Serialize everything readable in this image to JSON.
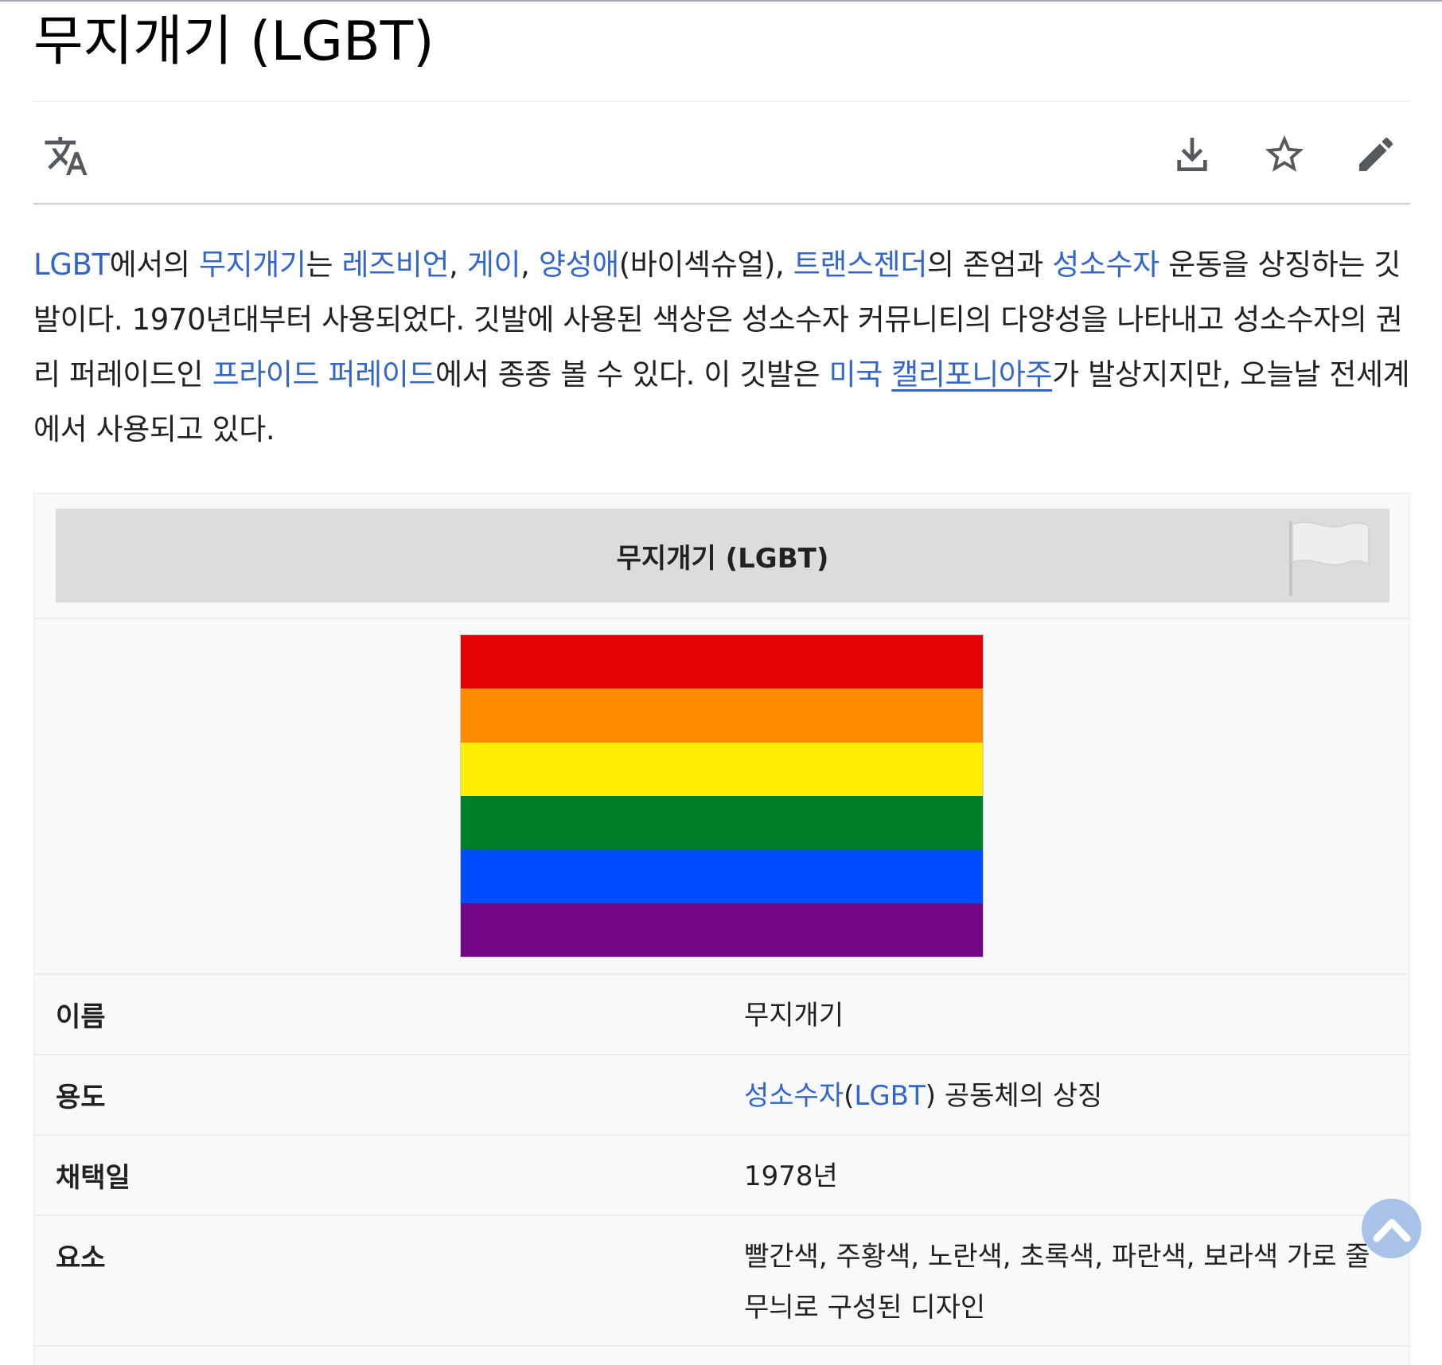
{
  "page": {
    "title": "무지개기 (LGBT)"
  },
  "toolbar": {
    "language_icon": "translate-icon",
    "download_icon": "download-icon",
    "watch_icon": "star-icon",
    "edit_icon": "pencil-icon"
  },
  "intro": {
    "s1": "LGBT",
    "s2": "에서의 ",
    "s3": "무지개기",
    "s4": "는 ",
    "s5": "레즈비언",
    "s6": ", ",
    "s7": "게이",
    "s8": ", ",
    "s9": "양성애",
    "s10": "(바이섹슈얼), ",
    "s11": "트랜스젠더",
    "s12": "의 존엄과 ",
    "s13": "성소수자",
    "s14": " 운동을 상징하는 깃발이다. 1970년대부터 사용되었다. 깃발에 사용된 색상은 성소수자 커뮤니티의 다양성을 나타내고 성소수자의 권리 퍼레이드인 ",
    "s15": "프라이드 퍼레이드",
    "s16": "에서 종종 볼 수 있다. 이 깃발은 ",
    "s17": "미국",
    "s18": " ",
    "s19": "캘리포니아주",
    "s20": "가 발상지지만, 오늘날 전세계에서 사용되고 있다."
  },
  "infobox": {
    "header": "무지개기 (LGBT)",
    "header_icon": "white-flag-icon",
    "flag_colors": [
      "#e40303",
      "#ff8c00",
      "#ffed00",
      "#008026",
      "#004dff",
      "#750787"
    ],
    "rows": [
      {
        "label": "이름",
        "value": "무지개기"
      },
      {
        "label": "용도",
        "link1": "성소수자",
        "mid": "(",
        "link2": "LGBT",
        "rest": ") 공동체의 상징"
      },
      {
        "label": "채택일",
        "value": "1978년"
      },
      {
        "label": "요소",
        "value": "빨간색, 주황색, 노란색, 초록색, 파란색, 보라색 가로 줄무늬로 구성된 디자인"
      }
    ]
  },
  "scroll_top_icon": "chevron-up-icon"
}
